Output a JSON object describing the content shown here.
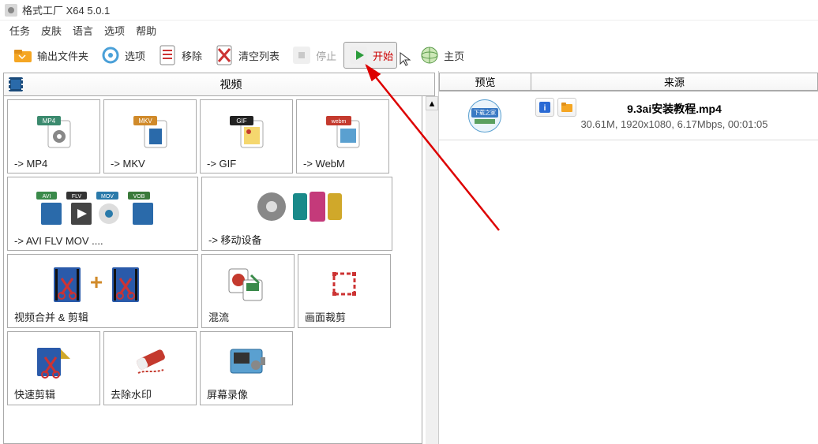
{
  "window": {
    "title": "格式工厂 X64 5.0.1"
  },
  "menu": [
    "任务",
    "皮肤",
    "语言",
    "选项",
    "帮助"
  ],
  "toolbar": {
    "output_folder": "输出文件夹",
    "options": "选项",
    "remove": "移除",
    "clear_list": "清空列表",
    "stop": "停止",
    "start": "开始",
    "home": "主页"
  },
  "left": {
    "header": "视频",
    "cells": [
      {
        "label": "-> MP4",
        "badge": "MP4",
        "bcolor": "#3b8a6e",
        "w": 1
      },
      {
        "label": "-> MKV",
        "badge": "MKV",
        "bcolor": "#d08a2a",
        "w": 1
      },
      {
        "label": "-> GIF",
        "badge": "GIF",
        "bcolor": "#222",
        "w": 1
      },
      {
        "label": "-> WebM",
        "badge": "webm",
        "bcolor": "#c43a2e",
        "w": 1
      },
      {
        "label": "-> AVI FLV MOV ....",
        "w": 2
      },
      {
        "label": "-> 移动设备",
        "w": 2
      },
      {
        "label": "视频合并 & 剪辑",
        "w": 2
      },
      {
        "label": "混流",
        "w": 1
      },
      {
        "label": "画面裁剪",
        "w": 1
      },
      {
        "label": "快速剪辑",
        "w": 1
      },
      {
        "label": "去除水印",
        "w": 1
      },
      {
        "label": "屏幕录像",
        "w": 1
      }
    ]
  },
  "right": {
    "col_preview": "预览",
    "col_source": "来源",
    "item": {
      "title": "9.3ai安装教程.mp4",
      "meta": "30.61M, 1920x1080, 6.17Mbps, 00:01:05",
      "thumb_caption": "下载之家"
    }
  }
}
